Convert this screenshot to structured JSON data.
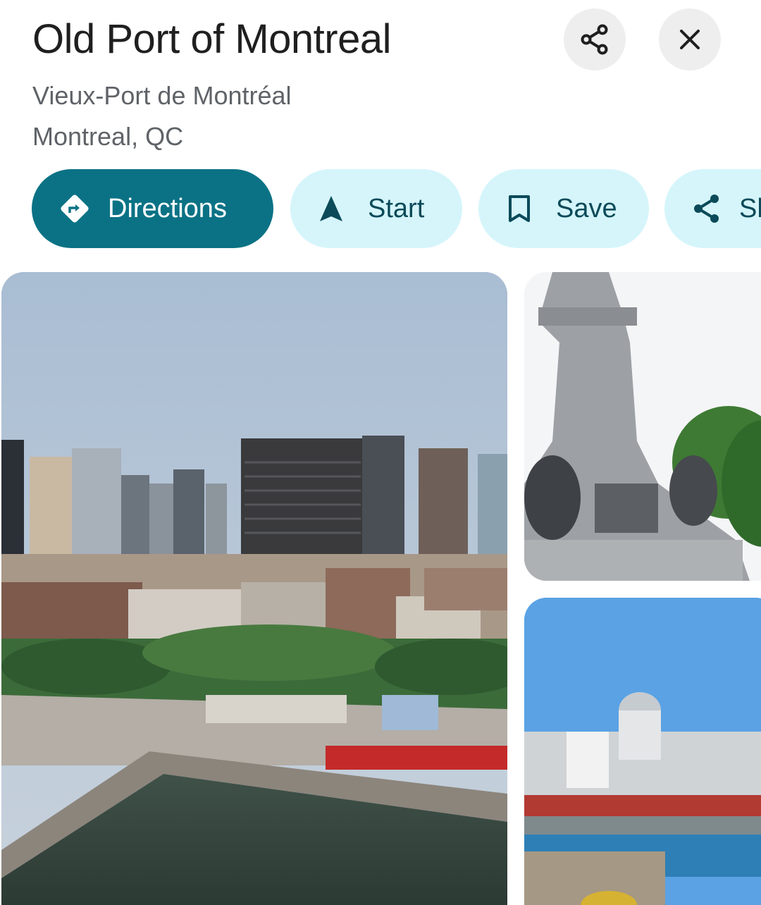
{
  "place": {
    "name": "Old Port of Montreal",
    "local_name": "Vieux-Port de Montréal",
    "location": "Montreal, QC"
  },
  "header_buttons": {
    "share_icon": "share-icon",
    "close_icon": "close-icon"
  },
  "actions": {
    "directions_label": "Directions",
    "start_label": "Start",
    "save_label": "Save",
    "share_label": "Sh"
  },
  "colors": {
    "primary_chip": "#0b7285",
    "tonal_chip": "#d5f5fb",
    "tonal_text": "#0b4a59",
    "round_button": "#eeeeee"
  },
  "photos": [
    {
      "subject": "aerial view of Old Port and downtown skyline"
    },
    {
      "subject": "stone monument with bronze statues"
    },
    {
      "subject": "Bonsecours Market dome and harbor"
    }
  ]
}
